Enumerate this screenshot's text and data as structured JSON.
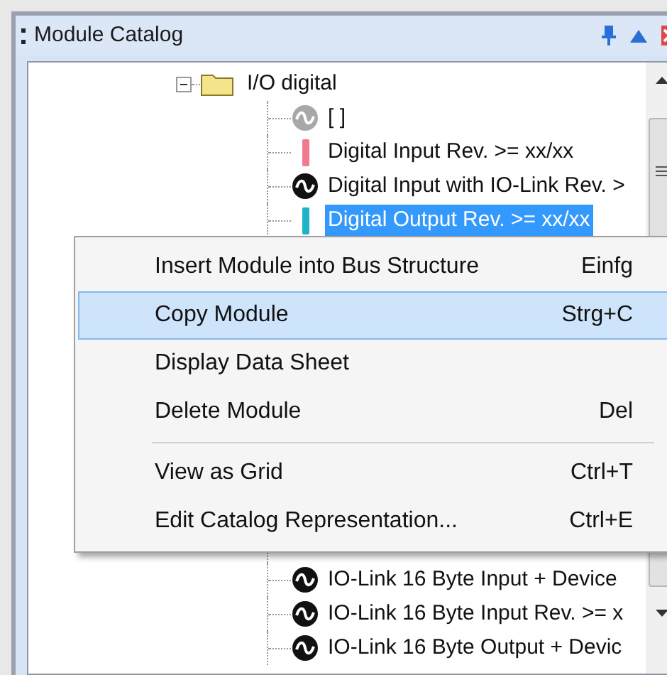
{
  "panel": {
    "title": "Module Catalog"
  },
  "tree": {
    "label": "I/O digital",
    "expanded": true,
    "children": [
      {
        "label": "[ ]",
        "kind": "wave-grey",
        "selected": false
      },
      {
        "label": "Digital Input Rev. >= xx/xx",
        "kind": "bar",
        "color": "#f27a8e",
        "selected": false
      },
      {
        "label": "Digital Input with IO-Link Rev. >",
        "kind": "wave",
        "selected": false
      },
      {
        "label": "Digital Output Rev. >= xx/xx",
        "kind": "bar",
        "color": "#1fb3c9",
        "selected": true
      }
    ],
    "more_children": [
      {
        "label": "IO-Link 16 Byte Input + Device",
        "kind": "wave",
        "selected": false
      },
      {
        "label": "IO-Link 16 Byte Input Rev. >= x",
        "kind": "wave",
        "selected": false
      },
      {
        "label": "IO-Link 16 Byte Output + Devic",
        "kind": "wave",
        "selected": false
      }
    ]
  },
  "context_menu": {
    "items": [
      {
        "kind": "item",
        "label": "Insert Module into Bus Structure",
        "shortcut": "Einfg",
        "selected": false
      },
      {
        "kind": "item",
        "label": "Copy Module",
        "shortcut": "Strg+C",
        "selected": true
      },
      {
        "kind": "item",
        "label": "Display Data Sheet",
        "selected": false
      },
      {
        "kind": "item",
        "label": "Delete Module",
        "shortcut": "Del",
        "selected": false
      },
      {
        "kind": "separator"
      },
      {
        "kind": "item",
        "label": "View as Grid",
        "shortcut": "Ctrl+T",
        "selected": false
      },
      {
        "kind": "item",
        "label": "Edit Catalog Representation...",
        "shortcut": "Ctrl+E",
        "selected": false
      }
    ]
  }
}
